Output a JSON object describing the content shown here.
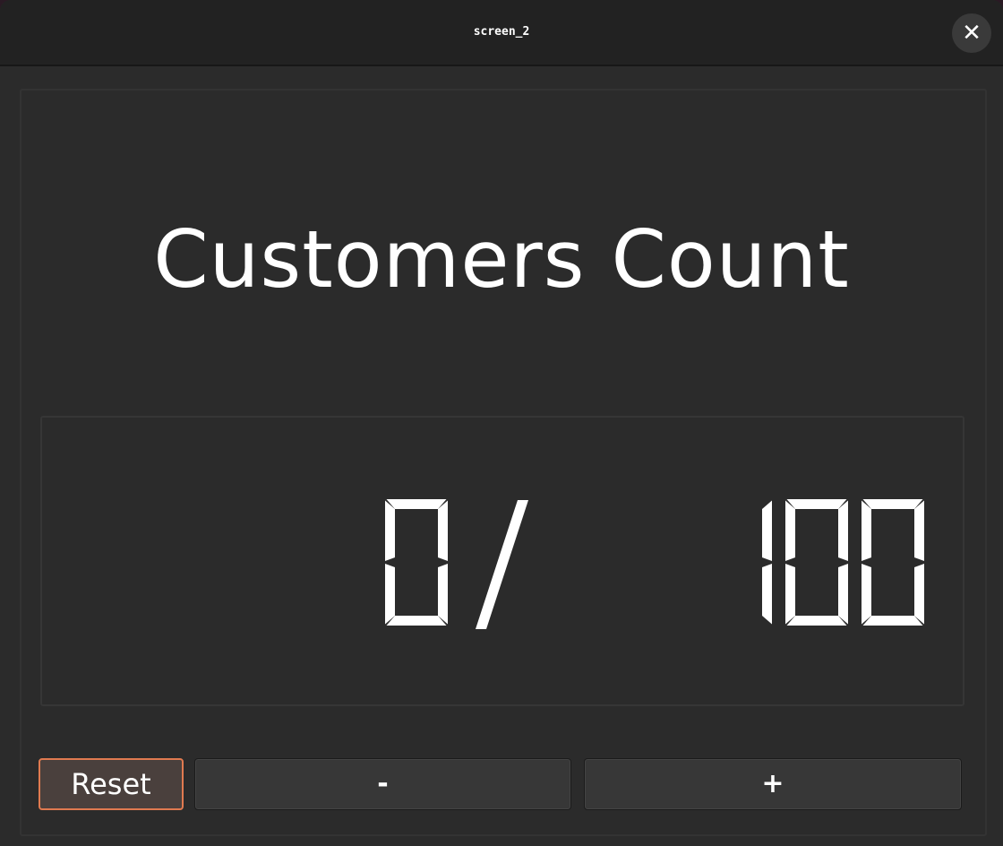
{
  "window": {
    "title": "screen_2",
    "close_icon": "close-icon"
  },
  "heading": "Customers Count",
  "counter": {
    "value": "0",
    "separator": "/",
    "max": "100"
  },
  "buttons": {
    "reset": "Reset",
    "decrement": "-",
    "increment": "+"
  },
  "colors": {
    "accent": "#e07a50",
    "background": "#2b2b2b",
    "titlebar": "#222222"
  }
}
